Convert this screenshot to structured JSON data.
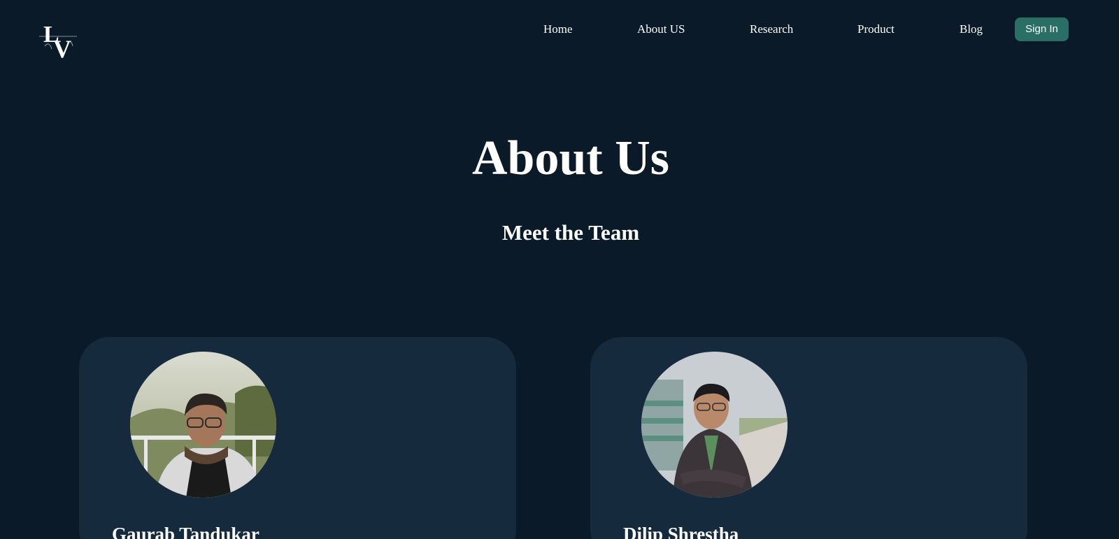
{
  "brand": {
    "logo_letters": "LV",
    "logo_tagline": "INSPIRED VINTAGE"
  },
  "nav": {
    "items": [
      {
        "label": "Home"
      },
      {
        "label": "About US"
      },
      {
        "label": "Research"
      },
      {
        "label": "Product"
      },
      {
        "label": "Blog"
      }
    ],
    "signin_label": "Sign In"
  },
  "page": {
    "title": "About Us",
    "subtitle": "Meet the Team"
  },
  "team": [
    {
      "name": "Gaurab Tandukar"
    },
    {
      "name": "Dilip Shrestha"
    }
  ],
  "colors": {
    "background": "#0a1a28",
    "card": "#152a3d",
    "accent_button": "#2a6f66"
  }
}
